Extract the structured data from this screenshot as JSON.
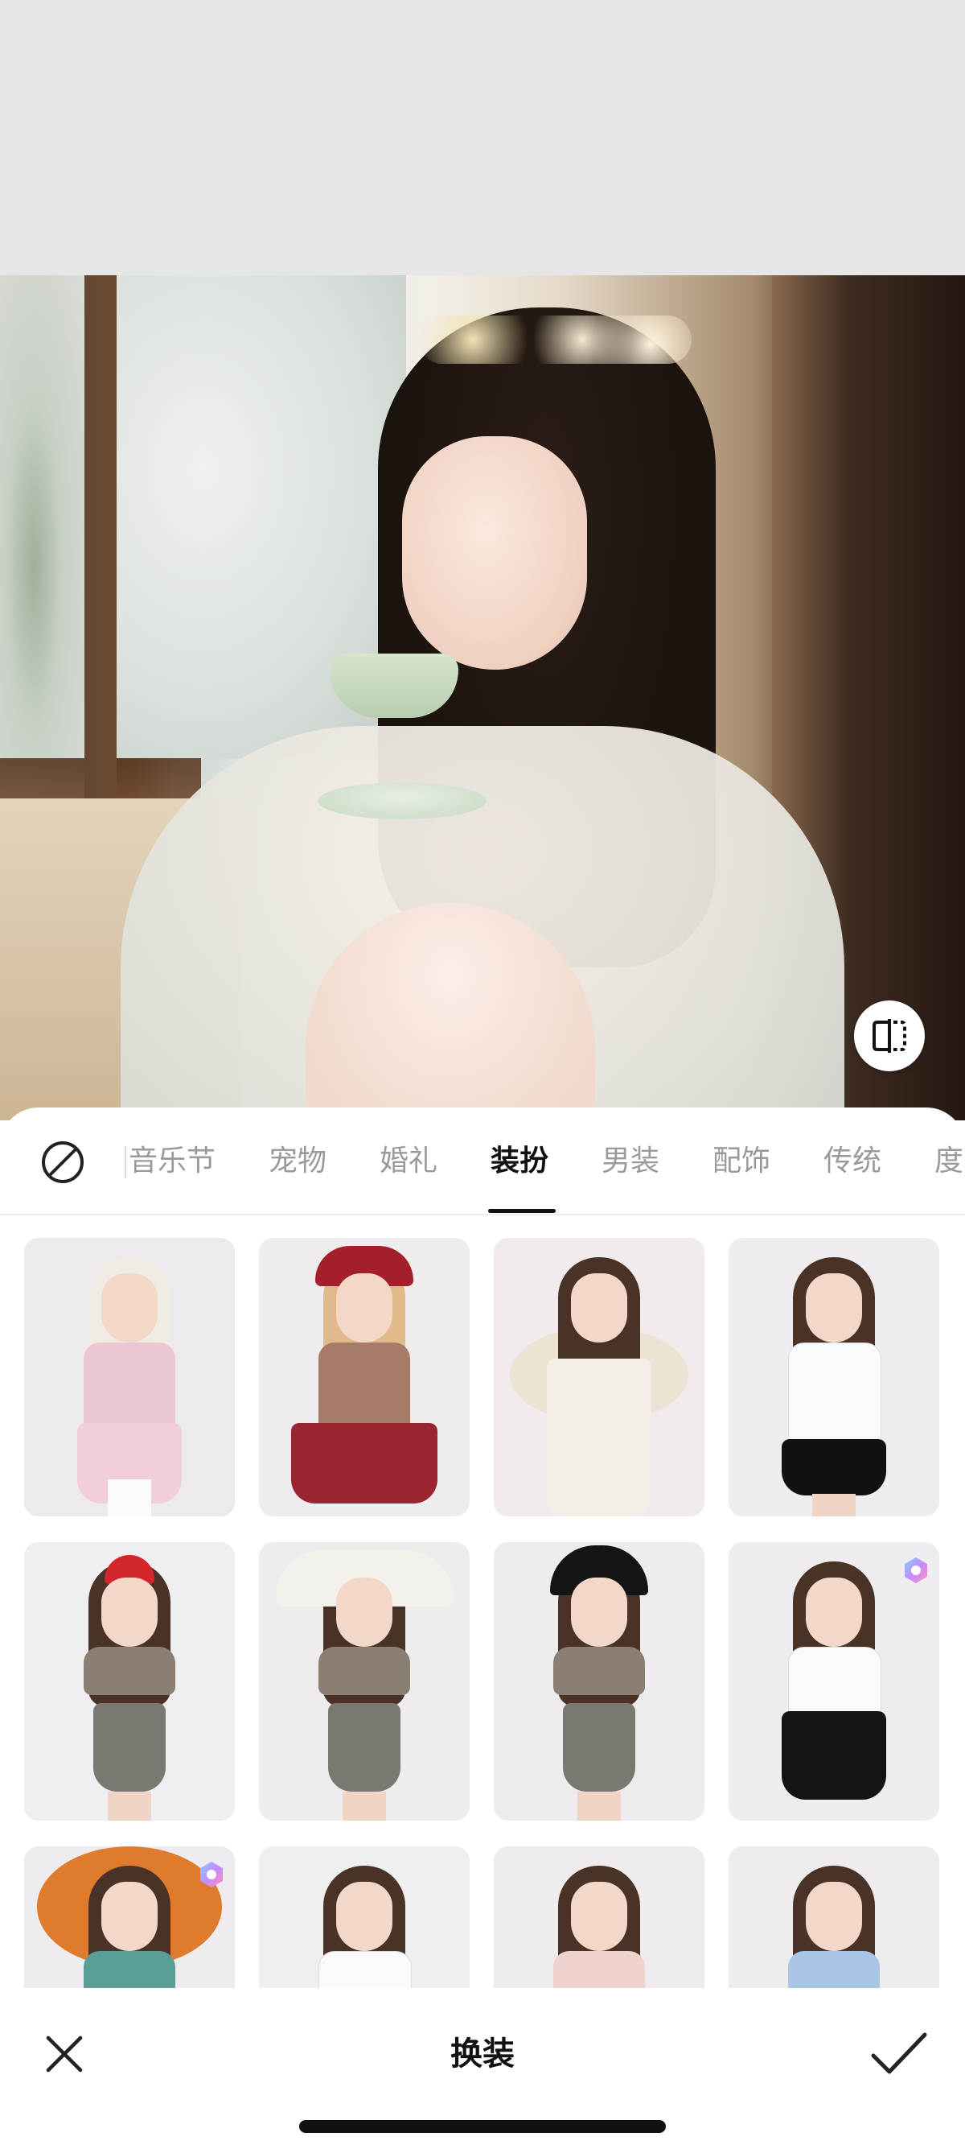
{
  "categories": {
    "tabs": [
      {
        "label": "音乐节"
      },
      {
        "label": "宠物"
      },
      {
        "label": "婚礼"
      },
      {
        "label": "装扮"
      },
      {
        "label": "男装"
      },
      {
        "label": "配饰"
      },
      {
        "label": "传统"
      },
      {
        "label": "度"
      }
    ],
    "active_tab": "装扮"
  },
  "outfits": [
    {
      "name": "pink lolita bunny outfit",
      "vip": false
    },
    {
      "name": "red floral lolita dress",
      "vip": false
    },
    {
      "name": "white angel wing gown",
      "vip": false
    },
    {
      "name": "white blouse black skirt",
      "vip": false
    },
    {
      "name": "pirate costume",
      "vip": false
    },
    {
      "name": "bunny ear hat costume",
      "vip": false
    },
    {
      "name": "witch hat costume",
      "vip": false
    },
    {
      "name": "black white lolita uniform",
      "vip": true
    },
    {
      "name": "feather headdress carnival",
      "vip": true
    },
    {
      "name": "white fitted top",
      "vip": false
    },
    {
      "name": "pink puff sleeve dress",
      "vip": false
    },
    {
      "name": "maid outfit",
      "vip": false
    }
  ],
  "toolbar": {
    "title": "换装"
  },
  "colors": {
    "active_text": "#111111",
    "inactive_text": "#9a9a9a",
    "sheet_bg": "#ffffff",
    "top_bg": "#e6e6e6"
  }
}
